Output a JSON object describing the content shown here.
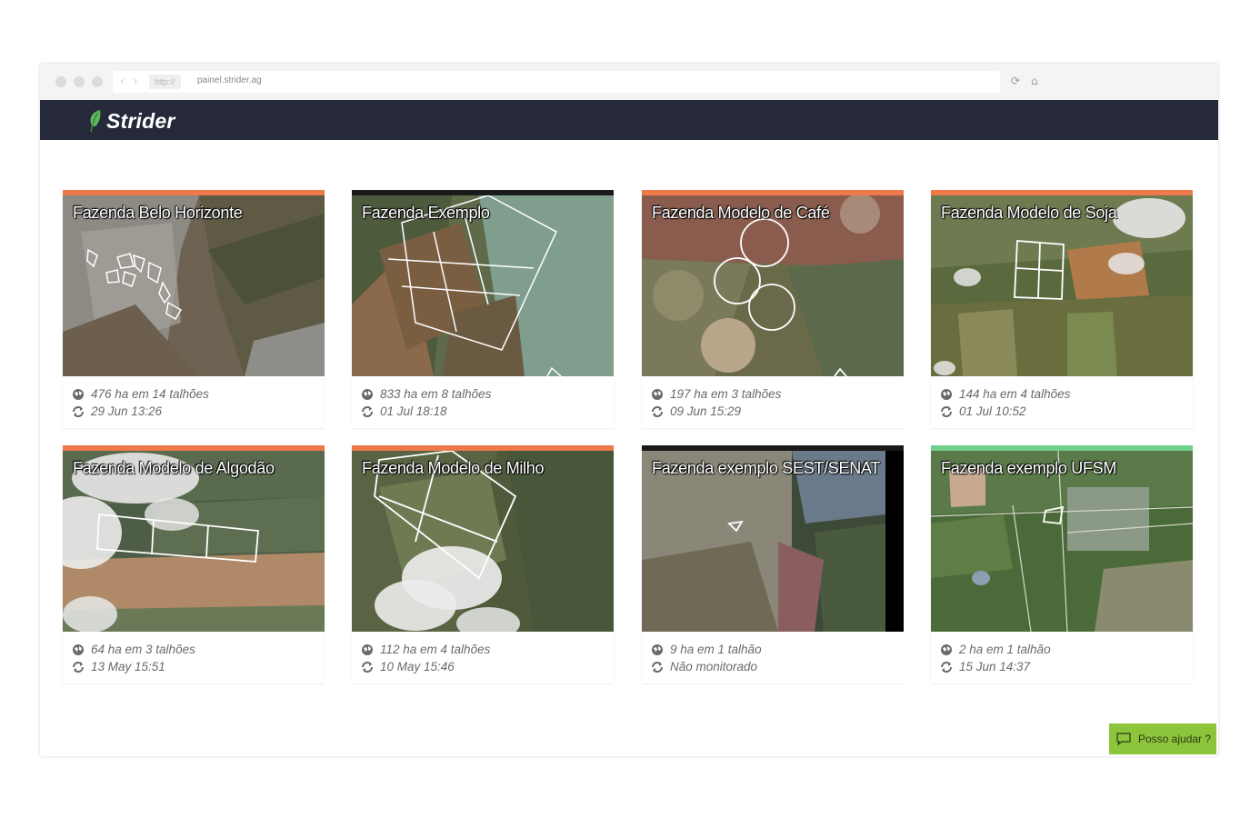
{
  "browser": {
    "protocol": "http://",
    "url": "painel.strider.ag",
    "nav_arrows": "‹ ›",
    "reload_icon": "reload-icon",
    "home_icon": "home-icon"
  },
  "app": {
    "logo_text": "Strider",
    "brand_color": "#5cb85c",
    "header_color": "#252939"
  },
  "farms": [
    {
      "name": "Fazenda Belo Horizonte",
      "area": "476 ha em 14 talhões",
      "updated": "29 Jun 13:26",
      "status_color": "#ee7a4b"
    },
    {
      "name": "Fazenda Exemplo",
      "area": "833 ha em 8 talhões",
      "updated": "01 Jul 18:18",
      "status_color": "#1a1a1a"
    },
    {
      "name": "Fazenda Modelo de Café",
      "area": "197 ha em 3 talhões",
      "updated": "09 Jun 15:29",
      "status_color": "#ee7a4b"
    },
    {
      "name": "Fazenda Modelo de Soja",
      "area": "144 ha em 4 talhões",
      "updated": "01 Jul 10:52",
      "status_color": "#ee7a4b"
    },
    {
      "name": "Fazenda Modelo de Algodão",
      "area": "64 ha em 3 talhões",
      "updated": "13 May 15:51",
      "status_color": "#ee7a4b"
    },
    {
      "name": "Fazenda Modelo de Milho",
      "area": "112 ha em 4 talhões",
      "updated": "10 May 15:46",
      "status_color": "#ee7a4b"
    },
    {
      "name": "Fazenda exemplo SEST/SENAT",
      "area": "9 ha em 1 talhão",
      "updated": "Não monitorado",
      "status_color": "#1a1a1a"
    },
    {
      "name": "Fazenda exemplo UFSM",
      "area": "2 ha em 1 talhão",
      "updated": "15 Jun 14:37",
      "status_color": "#6fd08c"
    }
  ],
  "help_widget": {
    "label": "Posso ajudar ?",
    "color": "#8cc43c"
  }
}
